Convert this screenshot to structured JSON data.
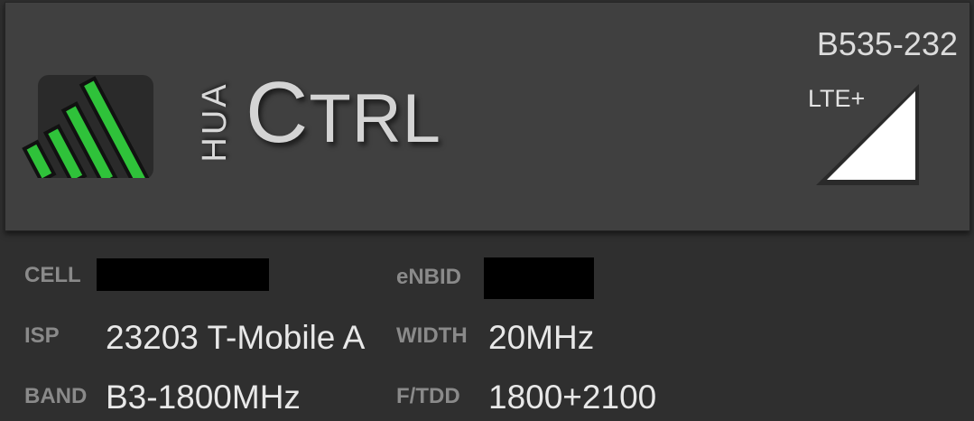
{
  "header": {
    "logo": {
      "hua": "HUA",
      "ctrl_first": "C",
      "ctrl_rest": "TRL"
    },
    "model": "B535-232",
    "network_type": "LTE+",
    "signal_level": 1.0,
    "logo_bar_color": "#2fc23a",
    "icon_name": "signal-bars-icon"
  },
  "info": {
    "cell": {
      "label": "CELL",
      "value": ""
    },
    "enbid": {
      "label": "eNBID",
      "value": ""
    },
    "isp": {
      "label": "ISP",
      "value": "23203 T-Mobile A"
    },
    "width": {
      "label": "WIDTH",
      "value": "20MHz"
    },
    "band": {
      "label": "BAND",
      "value": "B3-1800MHz"
    },
    "ftdd": {
      "label": "F/TDD",
      "value": "1800+2100"
    }
  }
}
